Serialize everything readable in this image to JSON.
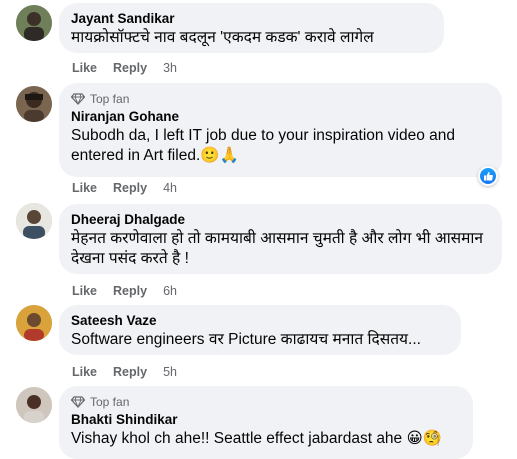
{
  "comments": [
    {
      "name": "Jayant Sandikar",
      "text": "मायक्रोसॉफ्टचे नाव बदलून 'एकदम कडक' करावे लागेल",
      "like_label": "Like",
      "reply_label": "Reply",
      "time": "3h"
    },
    {
      "badge": "Top fan",
      "name": "Niranjan Gohane",
      "text": "Subodh da, I left IT job due to your inspiration video and entered in Art filed.🙂🙏",
      "like_label": "Like",
      "reply_label": "Reply",
      "time": "4h",
      "reaction_icon": "thumbs-up-icon"
    },
    {
      "name": "Dheeraj Dhalgade",
      "text": "मेहनत करणेवाला हो तो कामयाबी आसमान चुमती है और लोग भी आसमान देखना पसंद करते है !",
      "like_label": "Like",
      "reply_label": "Reply",
      "time": "6h"
    },
    {
      "name": "Sateesh Vaze",
      "text": "Software engineers वर Picture काढायच मनात दिसतय...",
      "like_label": "Like",
      "reply_label": "Reply",
      "time": "5h"
    },
    {
      "badge": "Top fan",
      "name": "Bhakti Shindikar",
      "text": "Vishay khol ch ahe!! Seattle effect jabardast ahe 😀🧐",
      "like_label": "Like",
      "reply_label": "Reply",
      "time": ""
    }
  ],
  "colors": {
    "bubble": "#f0f2f5",
    "meta_text": "#65676b",
    "like_blue": "#1877f2"
  }
}
